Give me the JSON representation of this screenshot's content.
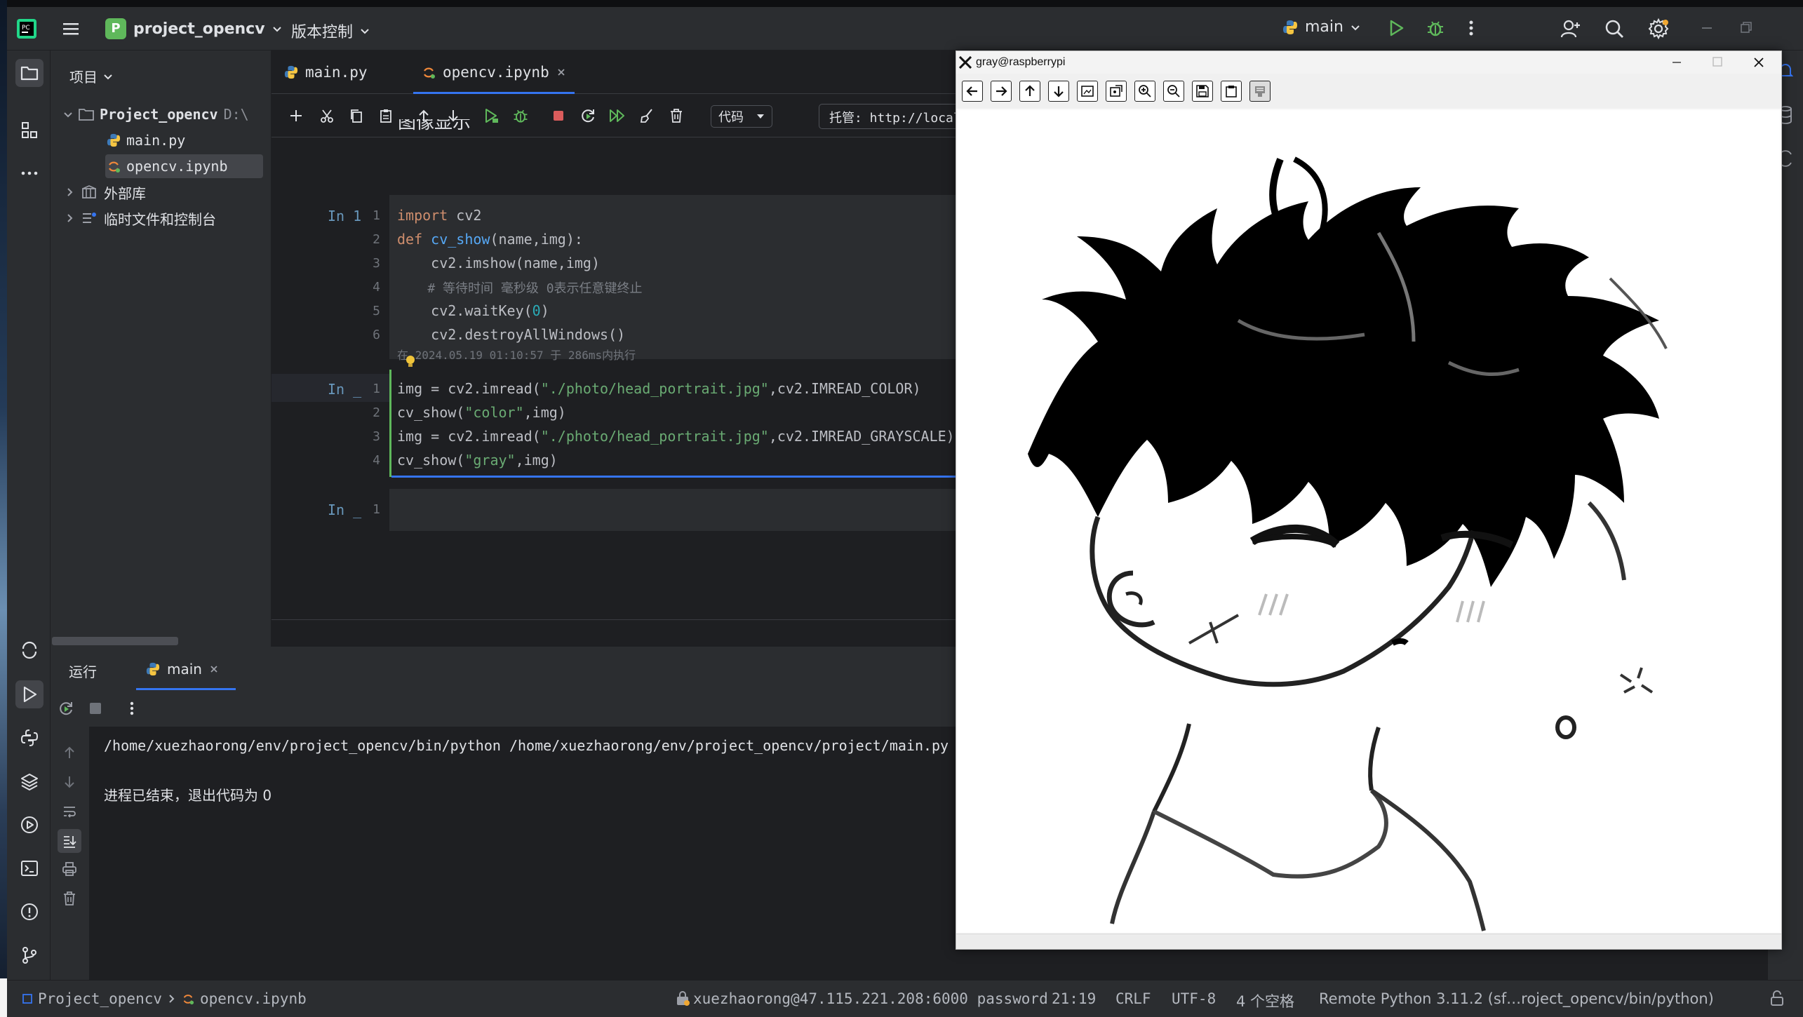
{
  "titlebar": {
    "project_badge": "P",
    "project_name": "project_opencv",
    "vcs_menu": "版本控制",
    "run_config": "main"
  },
  "project_panel": {
    "title": "项目",
    "root_name": "Project_opencv",
    "root_path": "D:\\",
    "files": [
      "main.py",
      "opencv.ipynb"
    ],
    "external_libs": "外部库",
    "scratches": "临时文件和控制台"
  },
  "editor": {
    "tabs": [
      {
        "label": "main.py"
      },
      {
        "label": "opencv.ipynb"
      }
    ],
    "cell_type": "代码",
    "hosted_label": "托管: http://localh",
    "partial_heading": "图像显示",
    "cells": [
      {
        "prompt": "In 1",
        "line_numbers": [
          "1",
          "2",
          "3",
          "4",
          "5",
          "6"
        ],
        "lines": [
          "import cv2",
          "def cv_show(name,img):",
          "    cv2.imshow(name,img)",
          "    # 等待时间 毫秒级 0表示任意键终止",
          "    cv2.waitKey(0)",
          "    cv2.destroyAllWindows()"
        ],
        "exec_info": "在 2024.05.19 01:10:57 于 286ms内执行"
      },
      {
        "prompt": "In _",
        "line_numbers": [
          "1",
          "2",
          "3",
          "4"
        ],
        "lines": [
          "img = cv2.imread(\"./photo/head_portrait.jpg\",cv2.IMREAD_COLOR)",
          "cv_show(\"color\",img)",
          "img = cv2.imread(\"./photo/head_portrait.jpg\",cv2.IMREAD_GRAYSCALE)",
          "cv_show(\"gray\",img)"
        ]
      },
      {
        "prompt": "In _",
        "line_numbers": [
          "1"
        ]
      }
    ]
  },
  "run_panel": {
    "title": "运行",
    "tab": "main",
    "command": "/home/xuezhaorong/env/project_opencv/bin/python /home/xuezhaorong/env/project_opencv/project/main.py",
    "exit_message": "进程已结束，退出代码为 0"
  },
  "statusbar": {
    "breadcrumb_project": "Project_opencv",
    "breadcrumb_file": "opencv.ipynb",
    "connection": "xuezhaorong@47.115.221.208:6000 password",
    "position": "21:19",
    "line_sep": "CRLF",
    "encoding": "UTF-8",
    "indent": "4 个空格",
    "interpreter": "Remote Python 3.11.2 (sf…roject_opencv/bin/python)"
  },
  "image_window": {
    "title": "gray@raspberrypi",
    "toolbar_icons": [
      "pan-left-icon",
      "pan-right-icon",
      "pan-up-icon",
      "pan-down-icon",
      "zoom-fit-icon",
      "zoom-original-icon",
      "zoom-in-icon",
      "zoom-out-icon",
      "save-icon",
      "copy-icon",
      "properties-icon"
    ]
  },
  "colors": {
    "accent": "#3574f0",
    "run_green": "#5fb85b",
    "stop_red": "#db5c5c",
    "bg_dark": "#1e1f22",
    "panel": "#2b2d30"
  }
}
